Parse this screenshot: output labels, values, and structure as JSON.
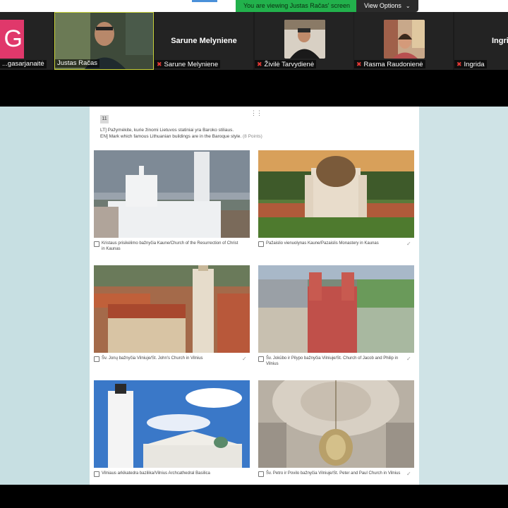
{
  "banner": {
    "viewing_text": "You are viewing Justas Račas' screen",
    "view_options_label": "View Options"
  },
  "participants": [
    {
      "name": "...gasarjanaitė",
      "avatar_letter": "G",
      "muted": false
    },
    {
      "name": "Justas Račas",
      "muted": false,
      "active": true
    },
    {
      "name": "Sarune Melyniene",
      "muted": true,
      "video": false
    },
    {
      "name": "Živilė Tarvydienė",
      "muted": true
    },
    {
      "name": "Rasma Raudonienė",
      "muted": true
    },
    {
      "name": "Ingrida",
      "muted": true,
      "video": false,
      "display": "Ingri"
    }
  ],
  "form": {
    "question_number": "11",
    "question_lt": "LT] Pažymėkite, kurie žinomi Lietuvos statiniai yra Baroko stiliaus.",
    "question_en": "EN] Mark which famous Lithuanian buildings are in the Baroque style.",
    "points": "(8 Points)",
    "options": [
      {
        "label": "Kristaus prisikėlimo bažnyčia Kaune/Church of the Resurrection of Christ in Kaunas",
        "checked": false
      },
      {
        "label": "Pažaislio vienuolynas Kaune/Pazaislis Monastery in Kaunas",
        "checked": false
      },
      {
        "label": "Šv. Jonų bažnyčia Vilniuje/St. John's Church in Vilnius",
        "checked": false
      },
      {
        "label": "Šv. Jokūbo ir Pilypo bažnyčia Vilniuje/St. Church of Jacob and Philip in Vilnius",
        "checked": false
      },
      {
        "label": "Vilniaus arkikatedra bazilika/Vilnius Archcathedral Basilica",
        "checked": false
      },
      {
        "label": "Šv. Petro ir Povilo bažnyčia Vilniuje/St. Peter and Paul Church in Vilnius",
        "checked": false
      }
    ]
  },
  "colors": {
    "banner_green": "#22b14c",
    "avatar_pink": "#e0386b",
    "muted_red": "#e53935",
    "active_border": "#c9d23a"
  }
}
